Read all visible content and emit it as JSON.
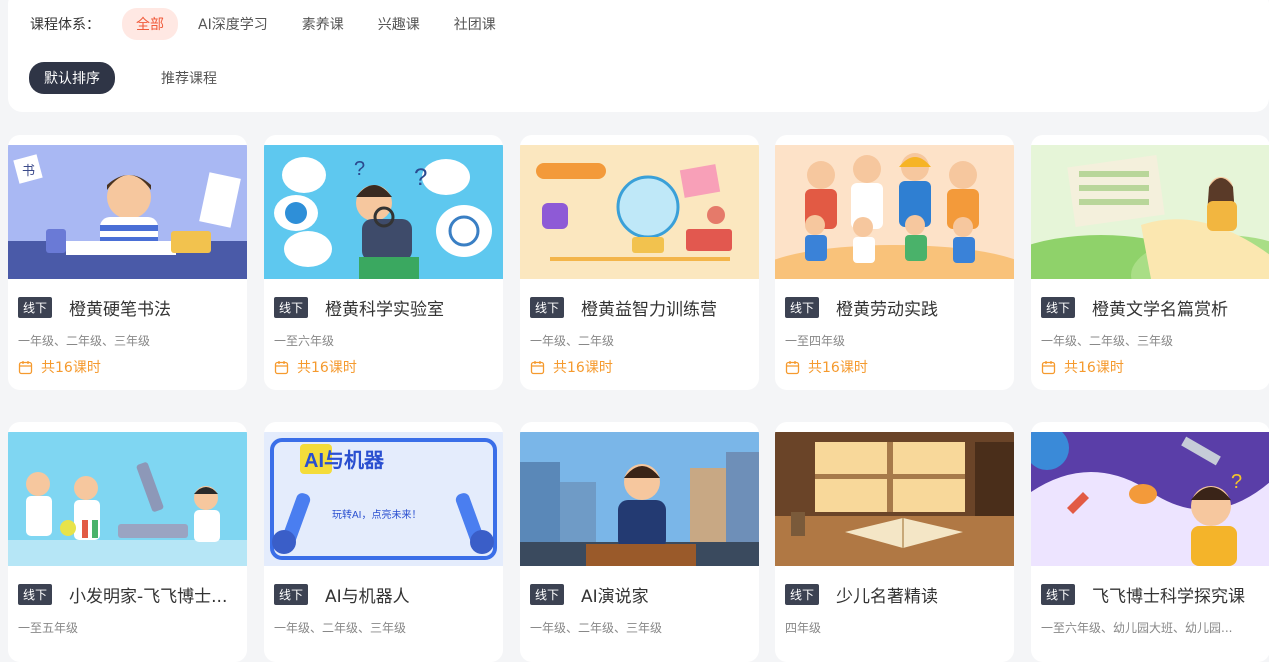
{
  "filters": {
    "label": "课程体系：",
    "categories": [
      "全部",
      "AI深度学习",
      "素养课",
      "兴趣课",
      "社团课"
    ],
    "active_category": "全部"
  },
  "sort": {
    "options": [
      "默认排序",
      "推荐课程"
    ],
    "active": "默认排序"
  },
  "colors": {
    "accent": "#f05a3a",
    "accent_bg": "#ffe8e3",
    "dark_chip": "#2f3546",
    "tag_bg": "#3c4252",
    "hours": "#f59a2e"
  },
  "courses": [
    {
      "tag": "线下",
      "title": "橙黄硬笔书法",
      "grades": "一年级、二年级、三年级",
      "hours": "共16课时",
      "icon": "calendar-icon"
    },
    {
      "tag": "线下",
      "title": "橙黄科学实验室",
      "grades": "一至六年级",
      "hours": "共16课时",
      "icon": "calendar-icon"
    },
    {
      "tag": "线下",
      "title": "橙黄益智力训练营",
      "grades": "一年级、二年级",
      "hours": "共16课时",
      "icon": "calendar-icon"
    },
    {
      "tag": "线下",
      "title": "橙黄劳动实践",
      "grades": "一至四年级",
      "hours": "共16课时",
      "icon": "calendar-icon"
    },
    {
      "tag": "线下",
      "title": "橙黄文学名篇赏析",
      "grades": "一年级、二年级、三年级",
      "hours": "共16课时",
      "icon": "calendar-icon"
    },
    {
      "tag": "线下",
      "title": "小发明家-飞飞博士...",
      "grades": "一至五年级",
      "hours": "",
      "icon": ""
    },
    {
      "tag": "线下",
      "title": "AI与机器人",
      "grades": "一年级、二年级、三年级",
      "hours": "",
      "icon": ""
    },
    {
      "tag": "线下",
      "title": "AI演说家",
      "grades": "一年级、二年级、三年级",
      "hours": "",
      "icon": ""
    },
    {
      "tag": "线下",
      "title": "少儿名著精读",
      "grades": "四年级",
      "hours": "",
      "icon": ""
    },
    {
      "tag": "线下",
      "title": "飞飞博士科学探究课",
      "grades": "一至六年级、幼儿园大班、幼儿园...",
      "hours": "",
      "icon": ""
    }
  ],
  "thumb_text": {
    "calligraphy_1": "书",
    "calligraphy_2": "橙黄硬笔书法",
    "robot_banner": "AI与机器",
    "robot_sub": "玩转AI，点亮未来！"
  }
}
